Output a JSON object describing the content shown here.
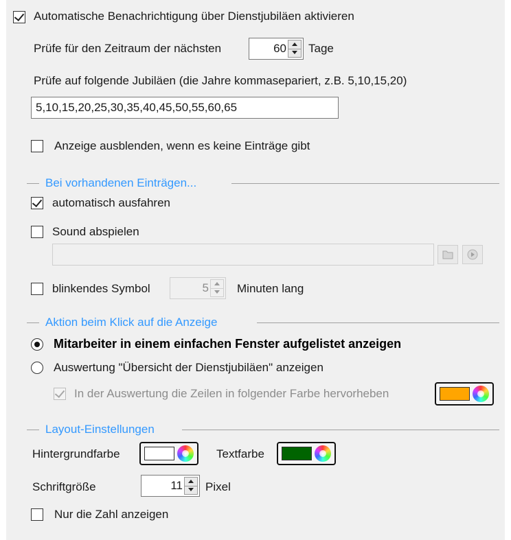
{
  "notify": {
    "enable_label": "Automatische Benachrichtigung über Dienstjubiläen aktivieren",
    "enable_checked": true,
    "period_prefix": "Prüfe für den Zeitraum der nächsten",
    "period_value": "60",
    "period_suffix": "Tage",
    "anniversaries_label": "Prüfe auf folgende Jubiläen (die Jahre kommasepariert, z.B. 5,10,15,20)",
    "anniversaries_value": "5,10,15,20,25,30,35,40,45,50,55,60,65",
    "hide_empty_label": "Anzeige ausblenden, wenn es keine Einträge gibt",
    "hide_empty_checked": false
  },
  "entries_group": {
    "title": "Bei vorhandenen Einträgen...",
    "auto_expand_label": "automatisch ausfahren",
    "auto_expand_checked": true,
    "sound_label": "Sound abspielen",
    "sound_checked": false,
    "sound_path": "",
    "blink_label": "blinkendes Symbol",
    "blink_checked": false,
    "blink_value": "5",
    "blink_suffix": "Minuten lang"
  },
  "click_group": {
    "title": "Aktion beim Klick auf die Anzeige",
    "option1_label": "Mitarbeiter in einem einfachen Fenster aufgelistet anzeigen",
    "option1_selected": true,
    "option2_label": "Auswertung \"Übersicht der Dienstjubiläen\" anzeigen",
    "option2_selected": false,
    "highlight_label": "In der Auswertung die Zeilen in folgender Farbe hervorheben",
    "highlight_checked": true,
    "highlight_color": "#ffa500"
  },
  "layout_group": {
    "title": "Layout-Einstellungen",
    "bg_label": "Hintergrundfarbe",
    "bg_color": "#ffffff",
    "text_label": "Textfarbe",
    "text_color": "#006400",
    "font_size_label": "Schriftgröße",
    "font_size_value": "11",
    "font_size_unit": "Pixel",
    "only_number_label": "Nur die Zahl anzeigen",
    "only_number_checked": false
  },
  "colors": {
    "group_title": "#3399ff",
    "panel_bg": "#f0f0f0"
  },
  "icons": {
    "sound_browse": "folder-icon",
    "sound_play": "play-icon",
    "color_wheel": "color-wheel-icon"
  }
}
